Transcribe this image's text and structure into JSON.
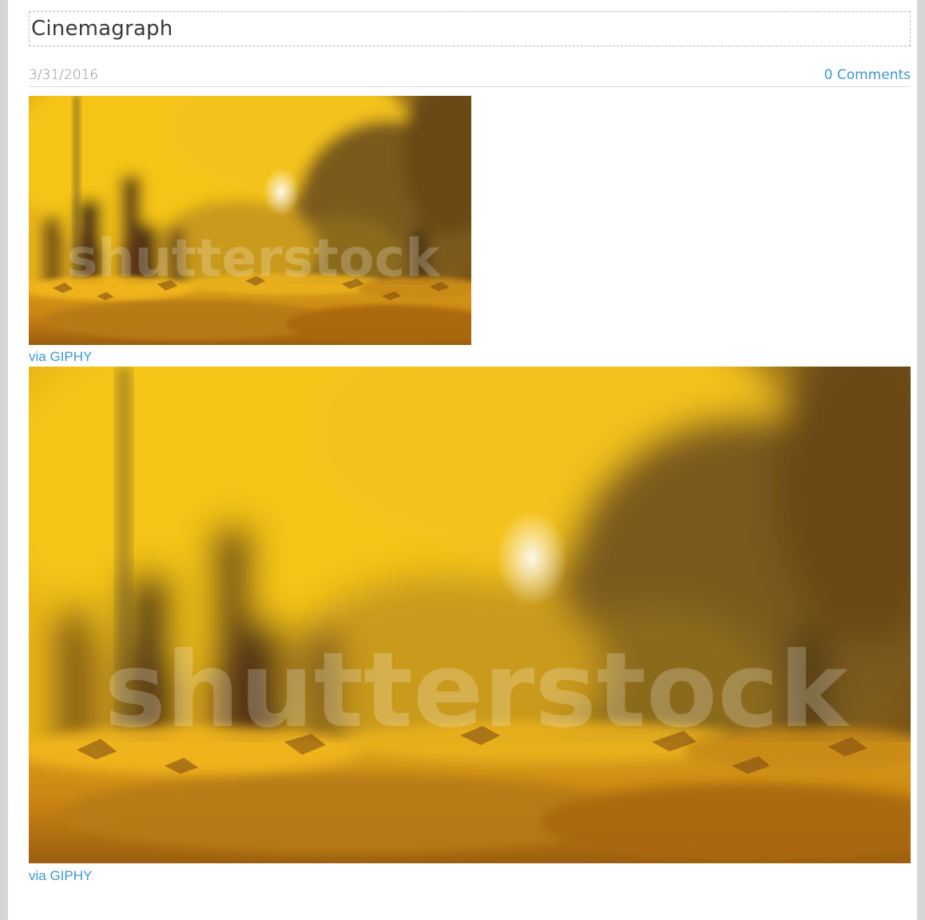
{
  "post": {
    "title": "Cinemagraph",
    "date": "3/31/2016",
    "comments_label": "0 Comments"
  },
  "media": [
    {
      "kind": "animated-gif-autumn-leaves",
      "watermark": "shutterstock",
      "credit_label": "via GIPHY"
    },
    {
      "kind": "animated-gif-autumn-leaves",
      "watermark": "shutterstock",
      "credit_label": "via GIPHY"
    }
  ],
  "colors": {
    "link": "#3c97d8",
    "title": "#3a3a3a",
    "meta": "#8e8e8e",
    "frame": "#d6d6d6"
  }
}
